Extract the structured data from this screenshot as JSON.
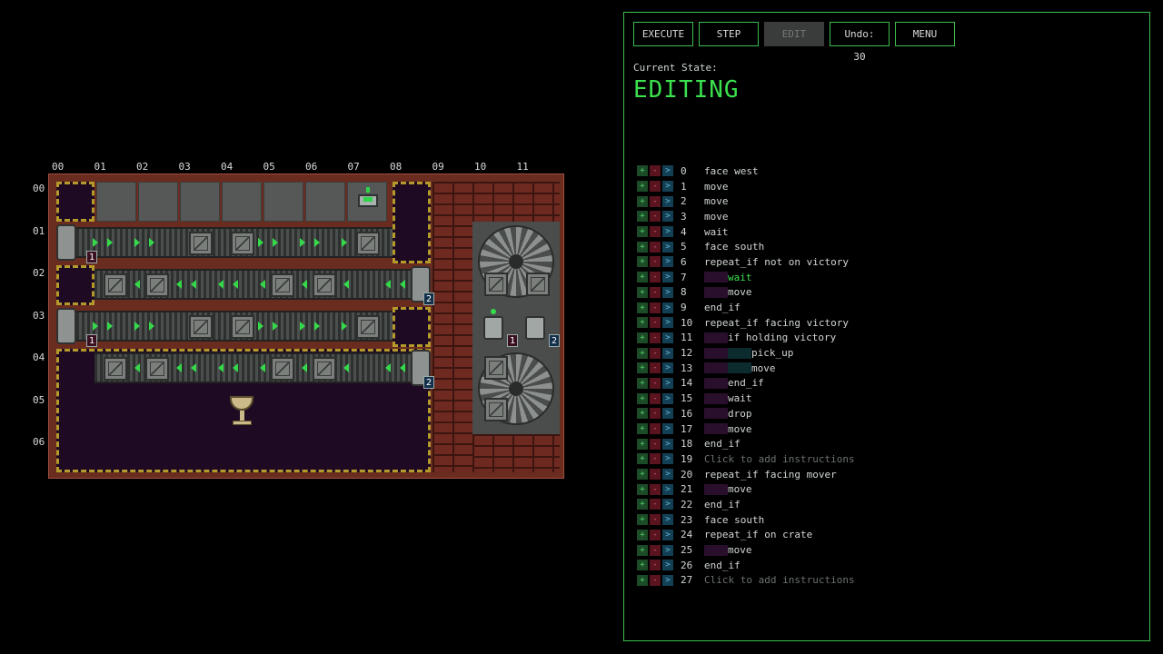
{
  "board": {
    "columns": [
      "00",
      "01",
      "02",
      "03",
      "04",
      "05",
      "06",
      "07",
      "08",
      "09",
      "10",
      "11"
    ],
    "rows": [
      "00",
      "01",
      "02",
      "03",
      "04",
      "05",
      "06"
    ],
    "spawner_labels": [
      "1",
      "2",
      "1",
      "2"
    ],
    "machine_labels": [
      "1",
      "2"
    ]
  },
  "toolbar": {
    "execute": "EXECUTE",
    "step": "STEP",
    "edit": "EDIT",
    "undo": "Undo: 30",
    "menu": "MENU"
  },
  "state": {
    "label": "Current State:",
    "value": "EDITING"
  },
  "controls": {
    "add": "+",
    "remove": "-",
    "goto": ">"
  },
  "program": [
    {
      "num": "0",
      "text": "face west",
      "indent": []
    },
    {
      "num": "1",
      "text": "move",
      "indent": []
    },
    {
      "num": "2",
      "text": "move",
      "indent": []
    },
    {
      "num": "3",
      "text": "move",
      "indent": []
    },
    {
      "num": "4",
      "text": "wait",
      "indent": []
    },
    {
      "num": "5",
      "text": "face south",
      "indent": []
    },
    {
      "num": "6",
      "text": "repeat_if not on victory",
      "indent": []
    },
    {
      "num": "7",
      "text": "wait",
      "indent": [
        "p"
      ],
      "active": true
    },
    {
      "num": "8",
      "text": "move",
      "indent": [
        "p"
      ]
    },
    {
      "num": "9",
      "text": "end_if",
      "indent": []
    },
    {
      "num": "10",
      "text": "repeat_if facing victory",
      "indent": []
    },
    {
      "num": "11",
      "text": "if holding victory",
      "indent": [
        "p"
      ]
    },
    {
      "num": "12",
      "text": "pick_up",
      "indent": [
        "p",
        "t"
      ]
    },
    {
      "num": "13",
      "text": "move",
      "indent": [
        "p",
        "t"
      ]
    },
    {
      "num": "14",
      "text": "end_if",
      "indent": [
        "p"
      ]
    },
    {
      "num": "15",
      "text": "wait",
      "indent": [
        "p"
      ]
    },
    {
      "num": "16",
      "text": "drop",
      "indent": [
        "p"
      ]
    },
    {
      "num": "17",
      "text": "move",
      "indent": [
        "p"
      ]
    },
    {
      "num": "18",
      "text": "end_if",
      "indent": []
    },
    {
      "num": "19",
      "text": "Click to add instructions",
      "indent": [],
      "hint": true
    },
    {
      "num": "20",
      "text": "repeat_if facing mover",
      "indent": []
    },
    {
      "num": "21",
      "text": "move",
      "indent": [
        "p"
      ]
    },
    {
      "num": "22",
      "text": "end_if",
      "indent": []
    },
    {
      "num": "23",
      "text": "face south",
      "indent": []
    },
    {
      "num": "24",
      "text": "repeat_if on crate",
      "indent": []
    },
    {
      "num": "25",
      "text": "move",
      "indent": [
        "p"
      ]
    },
    {
      "num": "26",
      "text": "end_if",
      "indent": []
    },
    {
      "num": "27",
      "text": "Click to add instructions",
      "indent": [],
      "hint": true
    }
  ]
}
